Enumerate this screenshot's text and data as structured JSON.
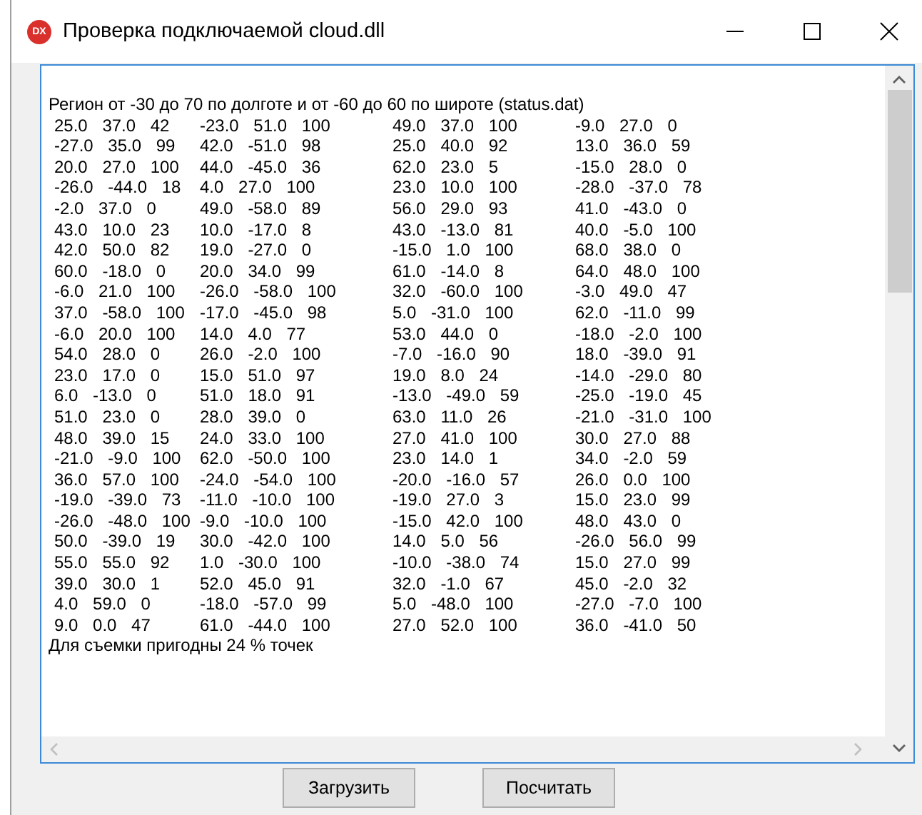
{
  "window": {
    "title": "Проверка подключаемой cloud.dll",
    "logo": "DX"
  },
  "memo": {
    "header": "Регион от -30 до 70 по долготе и от -60 до 60 по широте (status.dat)",
    "rows": [
      [
        "25.0 37.0 42",
        "-23.0 51.0 100",
        "49.0 37.0 100",
        "-9.0 27.0 0"
      ],
      [
        "-27.0 35.0 99",
        "42.0 -51.0 98",
        "25.0 40.0 92",
        "13.0 36.0 59"
      ],
      [
        "20.0 27.0 100",
        "44.0 -45.0 36",
        "62.0 23.0 5",
        "-15.0 28.0 0"
      ],
      [
        "-26.0 -44.0 18",
        "4.0 27.0 100",
        "23.0 10.0 100",
        "-28.0 -37.0 78"
      ],
      [
        "-2.0 37.0 0",
        "49.0 -58.0 89",
        "56.0 29.0 93",
        "41.0 -43.0 0"
      ],
      [
        "43.0 10.0 23",
        "10.0 -17.0 8",
        "43.0 -13.0 81",
        "40.0 -5.0 100"
      ],
      [
        "42.0 50.0 82",
        "19.0 -27.0 0",
        "-15.0 1.0 100",
        "68.0 38.0 0"
      ],
      [
        "60.0 -18.0 0",
        "20.0 34.0 99",
        "61.0 -14.0 8",
        "64.0 48.0 100"
      ],
      [
        "-6.0 21.0 100",
        "-26.0 -58.0 100",
        "32.0 -60.0 100",
        "-3.0 49.0 47"
      ],
      [
        "37.0 -58.0 100",
        "-17.0 -45.0 98",
        "5.0 -31.0 100",
        "62.0 -11.0 99"
      ],
      [
        "-6.0 20.0 100",
        "14.0 4.0 77",
        "53.0 44.0 0",
        "-18.0 -2.0 100"
      ],
      [
        "54.0 28.0 0",
        "26.0 -2.0 100",
        "-7.0 -16.0 90",
        "18.0 -39.0 91"
      ],
      [
        "23.0 17.0 0",
        "15.0 51.0 97",
        "19.0 8.0 24",
        "-14.0 -29.0 80"
      ],
      [
        "6.0 -13.0 0",
        "51.0 18.0 91",
        "-13.0 -49.0 59",
        "-25.0 -19.0 45"
      ],
      [
        "51.0 23.0 0",
        "28.0 39.0 0",
        "63.0 11.0 26",
        "-21.0 -31.0 100"
      ],
      [
        "48.0 39.0 15",
        "24.0 33.0 100",
        "27.0 41.0 100",
        "30.0 27.0 88"
      ],
      [
        "-21.0 -9.0 100",
        "62.0 -50.0 100",
        "23.0 14.0 1",
        "34.0 -2.0 59"
      ],
      [
        "36.0 57.0 100",
        "-24.0 -54.0 100",
        "-20.0 -16.0 57",
        "26.0 0.0 100"
      ],
      [
        "-19.0 -39.0 73",
        "-11.0 -10.0 100",
        "-19.0 27.0 3",
        "15.0 23.0 99"
      ],
      [
        "-26.0 -48.0 100",
        "-9.0 -10.0 100",
        "-15.0 42.0 100",
        "48.0 43.0 0"
      ],
      [
        "50.0 -39.0 19",
        "30.0 -42.0 100",
        "14.0 5.0 56",
        "-26.0 56.0 99"
      ],
      [
        "55.0 55.0 92",
        "1.0 -30.0 100",
        "-10.0 -38.0 74",
        "15.0 27.0 99"
      ],
      [
        "39.0 30.0 1",
        "52.0 45.0 91",
        "32.0 -1.0 67",
        "45.0 -2.0 32"
      ],
      [
        "4.0 59.0 0",
        "-18.0 -57.0 99",
        "5.0 -48.0 100",
        "-27.0 -7.0 100"
      ],
      [
        "9.0 0.0 47",
        "61.0 -44.0 100",
        "27.0 52.0 100",
        "36.0 -41.0 50"
      ]
    ],
    "footer": "Для съемки пригодны 24 % точек"
  },
  "buttons": [
    "Загрузить",
    "Посчитать"
  ]
}
